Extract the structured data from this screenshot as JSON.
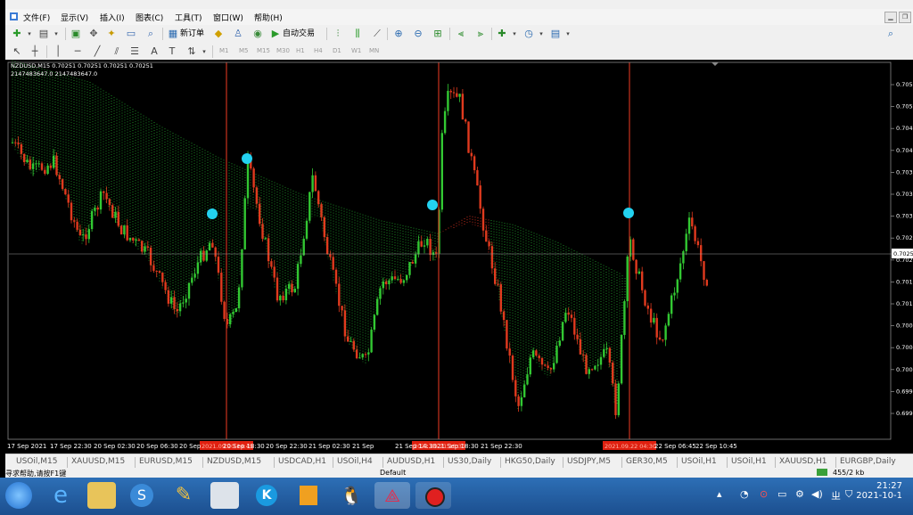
{
  "menu": {
    "items": [
      "文件(F)",
      "显示(V)",
      "插入(I)",
      "图表(C)",
      "工具(T)",
      "窗口(W)",
      "帮助(H)"
    ]
  },
  "toolbar": {
    "new_order": "新订单",
    "auto_trading": "自动交易",
    "timeframes": [
      "M1",
      "M5",
      "M15",
      "M30",
      "H1",
      "H4",
      "D1",
      "W1",
      "MN"
    ]
  },
  "chart": {
    "info_line1": "NZDUSD,M15  0.70251 0.70251 0.70251 0.70251",
    "info_line2": "2147483647.0   2147483647.0",
    "current_price": "0.7025",
    "price_labels": [
      "0.7056",
      "0.7052",
      "0.7047",
      "0.7043",
      "0.7039",
      "0.7034",
      "0.7030",
      "0.7026",
      "0.7021",
      "0.7017",
      "0.7013",
      "0.7008",
      "0.7004",
      "0.7000",
      "0.6996",
      "0.6991"
    ],
    "time_labels": [
      "17 Sep 2021",
      "17 Sep 22:30",
      "20 Sep 02:30",
      "20 Sep 06:30",
      "20 Sep",
      "20 Sep 18:30",
      "20 Sep 22:30",
      "21 Sep 02:30",
      "21 Sep",
      "21 Sep 14:30",
      "21 Sep 18:30",
      "21 Sep 22:30",
      "22 Sep 06:45",
      "22 Sep 10:45"
    ],
    "marker_labels": [
      "2021.09.20 14:45",
      "2021.09.21 10:30",
      "2021.09.22 04:30"
    ],
    "colors": {
      "bull": "#32c832",
      "bear": "#e03a1e",
      "marker": "#23d2f0",
      "vline": "#c8321e"
    }
  },
  "symbol_tabs": [
    "USOil,M15",
    "XAUUSD,M15",
    "EURUSD,M15",
    "NZDUSD,M15",
    "USDCAD,H1",
    "USOil,H4",
    "AUDUSD,H1",
    "US30,Daily",
    "HKG50,Daily",
    "USDJPY,M5",
    "GER30,M5",
    "USOil,H1",
    "USOil,H1",
    "XAUUSD,H1",
    "EURGBP,Daily"
  ],
  "status": {
    "help": "寻求帮助,请按F1键",
    "profile": "Default",
    "traffic": "455/2 kb"
  },
  "taskbar": {
    "time": "21:27",
    "date": "2021-10-1"
  }
}
